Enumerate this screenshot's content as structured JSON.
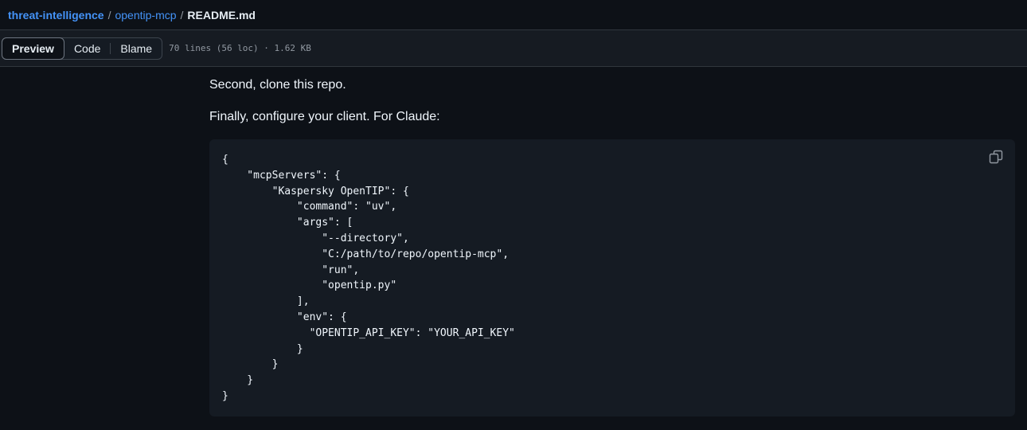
{
  "breadcrumb": {
    "owner": "threat-intelligence",
    "sep1": "/",
    "repo": "opentip-mcp",
    "sep2": "/",
    "file": "README.md"
  },
  "toolbar": {
    "tabs": [
      {
        "label": "Preview",
        "active": true
      },
      {
        "label": "Code",
        "active": false
      },
      {
        "label": "Blame",
        "active": false
      }
    ],
    "file_meta": "70 lines (56 loc) · 1.62 KB"
  },
  "content": {
    "paragraph_1": "Second, clone this repo.",
    "paragraph_2": "Finally, configure your client. For Claude:",
    "code_lines": [
      "{",
      "    \"mcpServers\": {",
      "        \"Kaspersky OpenTIP\": {",
      "            \"command\": \"uv\",",
      "            \"args\": [",
      "                \"--directory\",",
      "                \"C:/path/to/repo/opentip-mcp\",",
      "                \"run\",",
      "                \"opentip.py\"",
      "            ],",
      "            \"env\": {",
      "              \"OPENTIP_API_KEY\": \"YOUR_API_KEY\"",
      "            }",
      "        }",
      "    }",
      "}"
    ],
    "copy_icon": "copy-icon"
  },
  "colors": {
    "background": "#0d1117",
    "link": "#4493f8",
    "code_background": "#151b23"
  }
}
